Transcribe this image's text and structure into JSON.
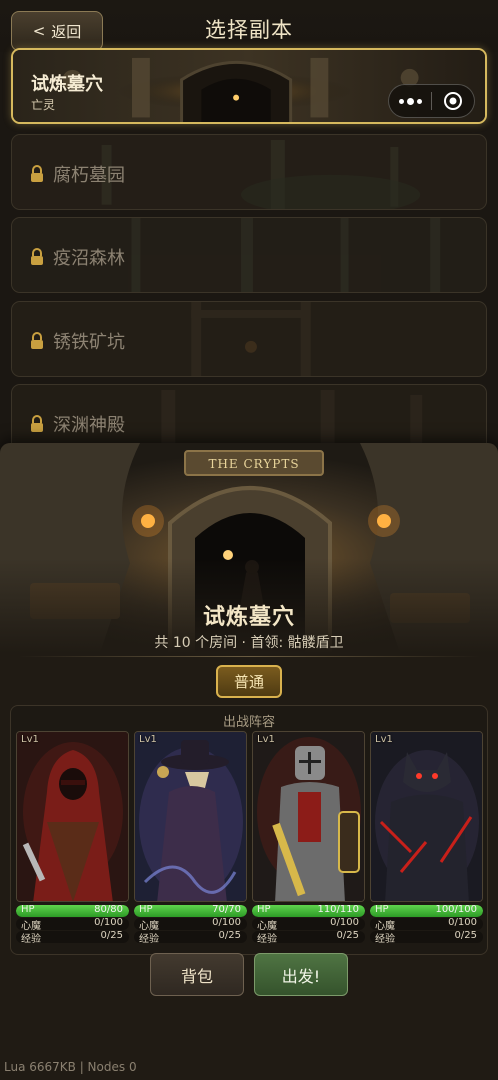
{
  "header": {
    "back_label": "返回",
    "title": "选择副本"
  },
  "dungeons": [
    {
      "name": "试炼墓穴",
      "subtitle": "亡灵",
      "locked": false
    },
    {
      "name": "腐朽墓园",
      "locked": true
    },
    {
      "name": "疫沼森林",
      "locked": true
    },
    {
      "name": "锈铁矿坑",
      "locked": true
    },
    {
      "name": "深渊神殿",
      "locked": true
    }
  ],
  "detail": {
    "banner_sign": "THE CRYPTS",
    "name": "试炼墓穴",
    "info": "共 10 个房间 · 首领: 骷髅盾卫",
    "difficulty": "普通"
  },
  "team": {
    "title": "出战阵容",
    "heroes": [
      {
        "level": "Lv1",
        "hp": "80/80",
        "hp_ratio": 1.0,
        "stress_label": "心魔",
        "stress": "0/100",
        "xp_label": "经验",
        "xp": "0/25",
        "theme": "crimson-rogue"
      },
      {
        "level": "Lv1",
        "hp": "70/70",
        "hp_ratio": 1.0,
        "stress_label": "心魔",
        "stress": "0/100",
        "xp_label": "经验",
        "xp": "0/25",
        "theme": "plague-doctor"
      },
      {
        "level": "Lv1",
        "hp": "110/110",
        "hp_ratio": 1.0,
        "stress_label": "心魔",
        "stress": "0/100",
        "xp_label": "经验",
        "xp": "0/25",
        "theme": "crusader-knight"
      },
      {
        "level": "Lv1",
        "hp": "100/100",
        "hp_ratio": 1.0,
        "stress_label": "心魔",
        "stress": "0/100",
        "xp_label": "经验",
        "xp": "0/25",
        "theme": "werewolf"
      }
    ],
    "hp_label": "HP"
  },
  "actions": {
    "bag_label": "背包",
    "go_label": "出发!"
  },
  "debug": "Lua 6667KB | Nodes 0",
  "colors": {
    "accent_gold": "#d6b95e",
    "hp_green": "#4cbf3c",
    "go_green": "#4f7443"
  }
}
